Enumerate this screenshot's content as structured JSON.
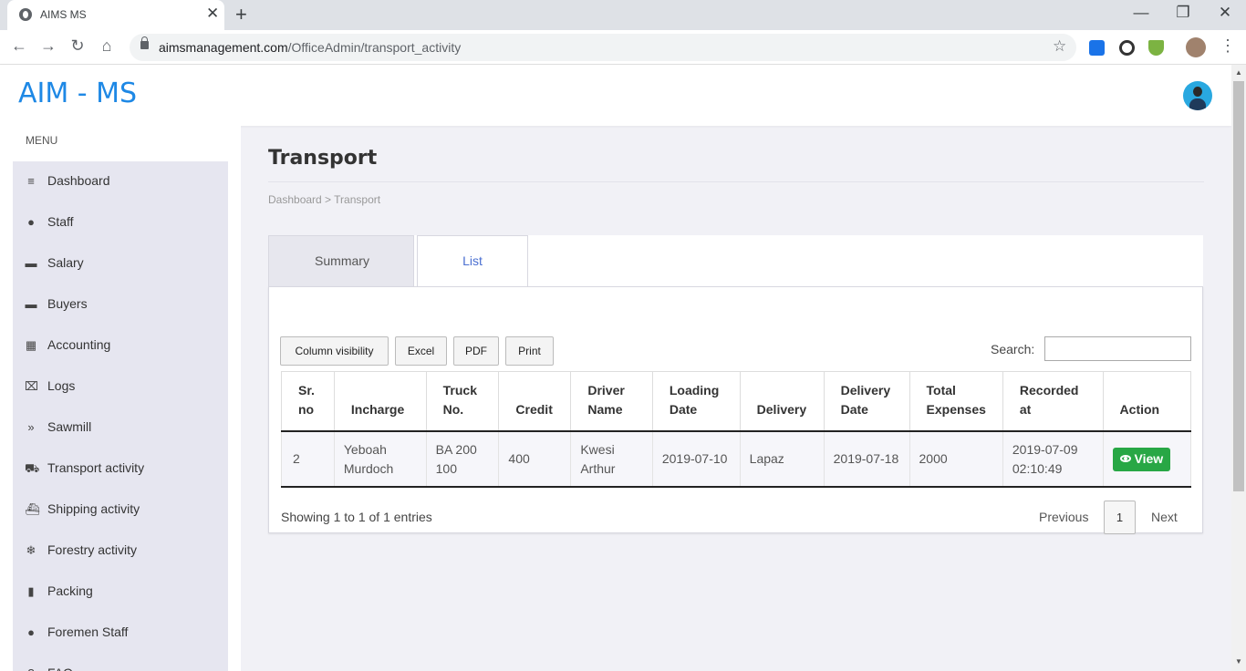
{
  "browser": {
    "tab_title": "AIMS MS",
    "tab_close": "✕",
    "new_tab": "+",
    "url_host": "aimsmanagement.com",
    "url_path": "/OfficeAdmin/transport_activity",
    "back": "←",
    "forward": "→",
    "reload": "↻",
    "home": "⌂",
    "star": "☆",
    "minimize": "—",
    "maximize": "❐",
    "close": "✕",
    "menu": "⋮",
    "extensions": [
      {
        "name": "search-extension-icon",
        "color": "#1a73e8"
      },
      {
        "name": "circle-extension-icon",
        "color": "#333333"
      },
      {
        "name": "download-extension-icon",
        "color": "#7cb342"
      }
    ]
  },
  "header": {
    "brand": "AIM - MS"
  },
  "sidebar": {
    "menu_label": "MENU",
    "items": [
      {
        "label": "Dashboard",
        "icon": "≡",
        "icon_name": "bars-icon"
      },
      {
        "label": "Staff",
        "icon": "●",
        "icon_name": "user-icon"
      },
      {
        "label": "Salary",
        "icon": "▬",
        "icon_name": "money-icon"
      },
      {
        "label": "Buyers",
        "icon": "▬",
        "icon_name": "money-icon"
      },
      {
        "label": "Accounting",
        "icon": "▦",
        "icon_name": "calendar-icon"
      },
      {
        "label": "Logs",
        "icon": "⌧",
        "icon_name": "logs-icon"
      },
      {
        "label": "Sawmill",
        "icon": "»",
        "icon_name": "double-chevron-icon"
      },
      {
        "label": "Transport activity",
        "icon": "⛟",
        "icon_name": "car-icon"
      },
      {
        "label": "Shipping activity",
        "icon": "⛴",
        "icon_name": "ship-icon"
      },
      {
        "label": "Forestry activity",
        "icon": "❄",
        "icon_name": "snowflake-icon"
      },
      {
        "label": "Packing",
        "icon": "▮",
        "icon_name": "suitcase-icon"
      },
      {
        "label": "Foremen Staff",
        "icon": "●",
        "icon_name": "user-icon"
      },
      {
        "label": "FAQ",
        "icon": "?",
        "icon_name": "question-icon"
      }
    ]
  },
  "main": {
    "title": "Transport",
    "breadcrumb": "Dashboard > Transport",
    "tabs": [
      {
        "label": "Summary",
        "active": false
      },
      {
        "label": "List",
        "active": true
      }
    ],
    "buttons": {
      "column_visibility": "Column visibility",
      "excel": "Excel",
      "pdf": "PDF",
      "print": "Print"
    },
    "search_label": "Search:",
    "search_value": "",
    "table": {
      "headers": [
        [
          "Sr.",
          "no"
        ],
        [
          "Incharge",
          ""
        ],
        [
          "Truck",
          "No."
        ],
        [
          "Credit",
          ""
        ],
        [
          "Driver",
          "Name"
        ],
        [
          "Loading",
          "Date"
        ],
        [
          "Delivery",
          ""
        ],
        [
          "Delivery",
          "Date"
        ],
        [
          "Total",
          "Expenses"
        ],
        [
          "Recorded",
          "at"
        ],
        [
          "Action",
          ""
        ]
      ],
      "rows": [
        {
          "sr_no": "2",
          "incharge": [
            "Yeboah",
            "Murdoch"
          ],
          "truck_no": [
            "BA 200",
            "100"
          ],
          "credit": "400",
          "driver_name": [
            "Kwesi",
            "Arthur"
          ],
          "loading_date": "2019-07-10",
          "delivery": "Lapaz",
          "delivery_date": "2019-07-18",
          "total_expenses": "2000",
          "recorded_at": [
            "2019-07-09",
            "02:10:49"
          ],
          "action": "View"
        }
      ]
    },
    "info": "Showing 1 to 1 of 1 entries",
    "pagination": {
      "previous": "Previous",
      "current": "1",
      "next": "Next"
    }
  },
  "colors": {
    "brand": "#1e88e5",
    "active_tab": "#4a6fd1",
    "view_button": "#28a745"
  }
}
